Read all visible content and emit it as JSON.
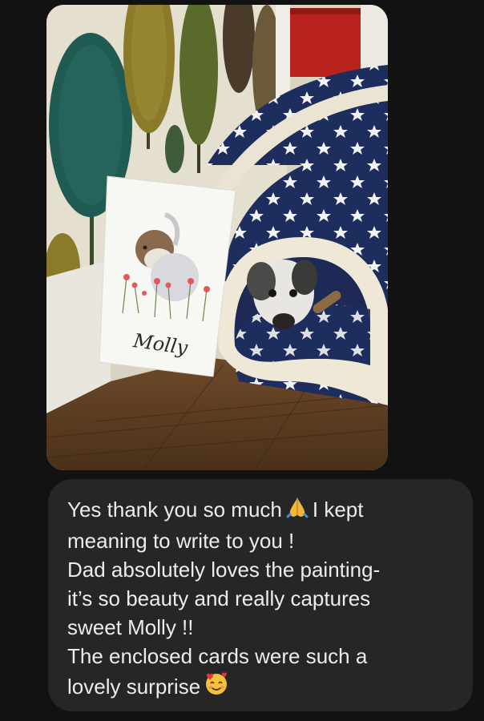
{
  "conversation": {
    "photo": {
      "painting_caption": "Molly"
    },
    "message": {
      "lines": [
        "Yes thank you so much",
        "I kept",
        "meaning to write to you !",
        "Dad absolutely loves the painting-",
        "it’s so beauty and really captures",
        "sweet Molly !!",
        "The enclosed cards were such a",
        "lovely surprise"
      ],
      "emojis": [
        "folded-hands-icon",
        "smiling-face-with-hearts-icon"
      ]
    }
  }
}
